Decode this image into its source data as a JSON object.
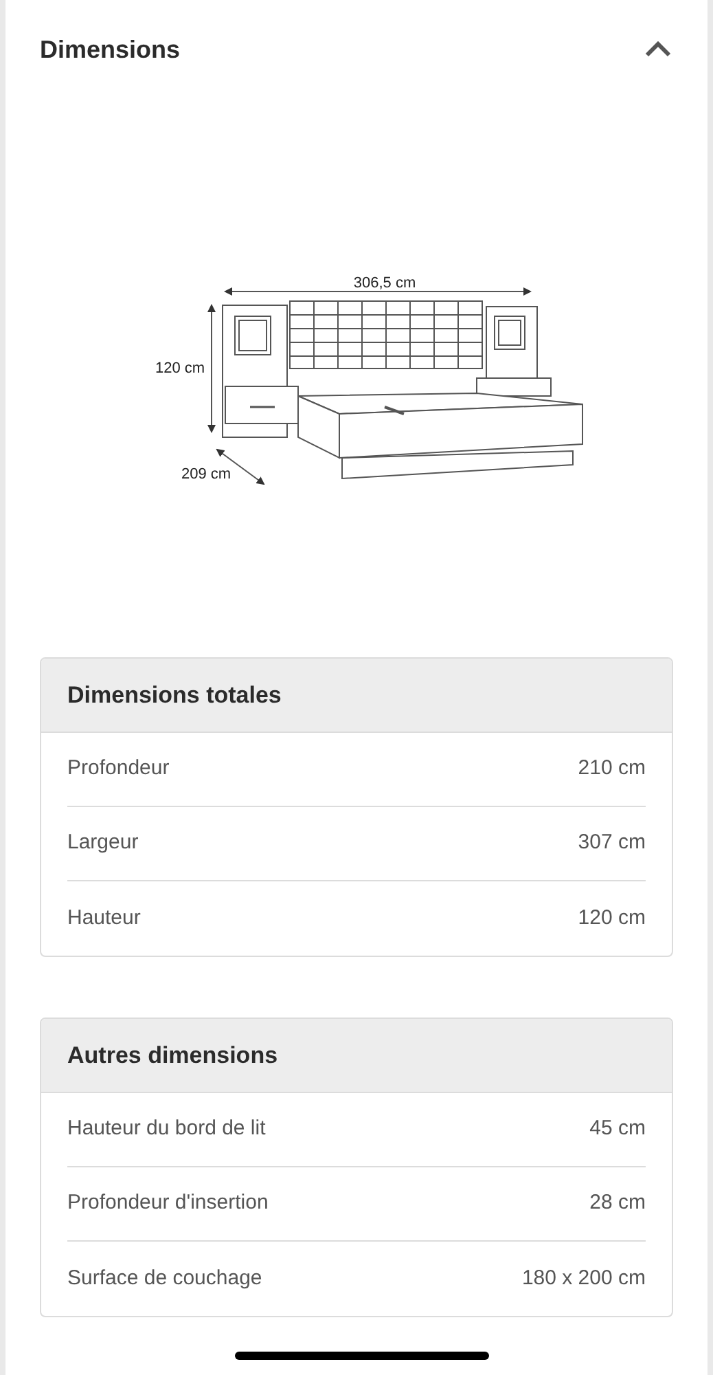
{
  "section": {
    "title": "Dimensions",
    "expanded": true
  },
  "drawing": {
    "width_label": "306,5 cm",
    "height_label": "120 cm",
    "depth_label": "209 cm"
  },
  "tables": [
    {
      "title": "Dimensions totales",
      "rows": [
        {
          "label": "Profondeur",
          "value": "210 cm"
        },
        {
          "label": "Largeur",
          "value": "307 cm"
        },
        {
          "label": "Hauteur",
          "value": "120 cm"
        }
      ]
    },
    {
      "title": "Autres dimensions",
      "rows": [
        {
          "label": "Hauteur du bord de lit",
          "value": "45 cm"
        },
        {
          "label": "Profondeur d'insertion",
          "value": "28 cm"
        },
        {
          "label": "Surface de couchage",
          "value": "180 x 200 cm"
        }
      ]
    }
  ]
}
